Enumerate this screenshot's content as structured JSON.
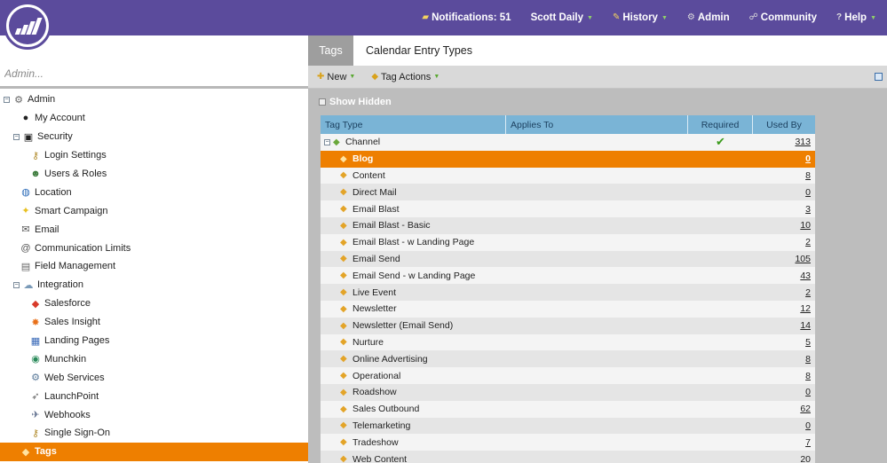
{
  "topnav": {
    "notifications_label": "Notifications: 51",
    "user_label": "Scott Daily",
    "history_label": "History",
    "admin_label": "Admin",
    "community_label": "Community",
    "help_label": "Help"
  },
  "search": {
    "placeholder": "Admin..."
  },
  "tree": [
    {
      "label": "Admin",
      "icon": "gear-icon",
      "level": 0,
      "expander": true
    },
    {
      "label": "My Account",
      "icon": "person-icon",
      "level": 1
    },
    {
      "label": "Security",
      "icon": "lock-icon",
      "level": 1,
      "expander": true
    },
    {
      "label": "Login Settings",
      "icon": "key-icon",
      "level": 2
    },
    {
      "label": "Users & Roles",
      "icon": "users-icon",
      "level": 2
    },
    {
      "label": "Location",
      "icon": "globe-icon",
      "level": 1
    },
    {
      "label": "Smart Campaign",
      "icon": "lightbulb-icon",
      "level": 1
    },
    {
      "label": "Email",
      "icon": "email-icon",
      "level": 1
    },
    {
      "label": "Communication Limits",
      "icon": "at-icon",
      "level": 1
    },
    {
      "label": "Field Management",
      "icon": "fields-icon",
      "level": 1
    },
    {
      "label": "Integration",
      "icon": "cloud-icon",
      "level": 1,
      "expander": true
    },
    {
      "label": "Salesforce",
      "icon": "salesforce-icon",
      "level": 2
    },
    {
      "label": "Sales Insight",
      "icon": "sales-insight-icon",
      "level": 2
    },
    {
      "label": "Landing Pages",
      "icon": "landing-pages-icon",
      "level": 2
    },
    {
      "label": "Munchkin",
      "icon": "munchkin-icon",
      "level": 2
    },
    {
      "label": "Web Services",
      "icon": "web-services-icon",
      "level": 2
    },
    {
      "label": "LaunchPoint",
      "icon": "rocket-icon",
      "level": 2
    },
    {
      "label": "Webhooks",
      "icon": "webhooks-icon",
      "level": 2
    },
    {
      "label": "Single Sign-On",
      "icon": "key-icon",
      "level": 2
    },
    {
      "label": "Tags",
      "icon": "tag-icon",
      "level": 1,
      "selected": true
    }
  ],
  "tabs": {
    "tags": "Tags",
    "calendar": "Calendar Entry Types"
  },
  "toolbar": {
    "new_label": "New",
    "tag_actions_label": "Tag Actions"
  },
  "show_hidden_label": "Show Hidden",
  "grid": {
    "headers": {
      "tag_type": "Tag Type",
      "applies_to": "Applies To",
      "required": "Required",
      "used_by": "Used By"
    },
    "parent": {
      "label": "Channel",
      "required": "✔",
      "used_by": "313"
    },
    "rows": [
      {
        "label": "Blog",
        "used_by": "0",
        "selected": true
      },
      {
        "label": "Content",
        "used_by": "8"
      },
      {
        "label": "Direct Mail",
        "used_by": "0"
      },
      {
        "label": "Email Blast",
        "used_by": "3"
      },
      {
        "label": "Email Blast - Basic",
        "used_by": "10"
      },
      {
        "label": "Email Blast - w Landing Page",
        "used_by": "2"
      },
      {
        "label": "Email Send",
        "used_by": "105"
      },
      {
        "label": "Email Send - w Landing Page",
        "used_by": "43"
      },
      {
        "label": "Live Event",
        "used_by": "2"
      },
      {
        "label": "Newsletter",
        "used_by": "12"
      },
      {
        "label": "Newsletter (Email Send)",
        "used_by": "14"
      },
      {
        "label": "Nurture",
        "used_by": "5"
      },
      {
        "label": "Online Advertising",
        "used_by": "8"
      },
      {
        "label": "Operational",
        "used_by": "8"
      },
      {
        "label": "Roadshow",
        "used_by": "0"
      },
      {
        "label": "Sales Outbound",
        "used_by": "62"
      },
      {
        "label": "Telemarketing",
        "used_by": "0"
      },
      {
        "label": "Tradeshow",
        "used_by": "7"
      },
      {
        "label": "Web Content",
        "used_by": "20"
      }
    ]
  },
  "colors": {
    "brand": "#5b4b9c",
    "selected": "#ee7f00",
    "grid_header": "#7ab4d6"
  }
}
